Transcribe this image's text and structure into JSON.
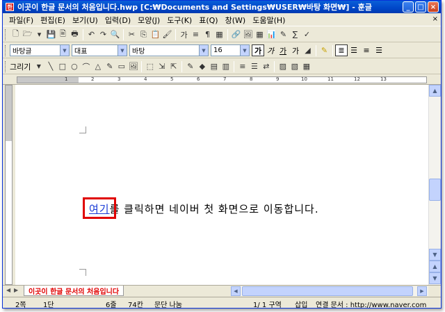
{
  "window": {
    "title": "이곳이 한글 문서의 처음입니다.hwp [C:₩Documents and Settings₩USER₩바탕 화면₩] - 훈글",
    "app_icon": "hwp-app-icon",
    "controls": {
      "minimize": "_",
      "maximize": "□",
      "close": "×"
    }
  },
  "menu": {
    "items": [
      "파일(F)",
      "편집(E)",
      "보기(U)",
      "입력(D)",
      "모양(J)",
      "도구(K)",
      "표(Q)",
      "창(W)",
      "도움말(H)"
    ],
    "close": "×"
  },
  "toolbar1": {
    "icons": [
      "new-doc-icon",
      "open-icon",
      "open-dropdown-icon",
      "save-icon",
      "print-preview-icon",
      "print-icon",
      "undo-icon",
      "redo-icon",
      "find-icon",
      "cut-icon",
      "copy-icon",
      "paste-icon",
      "format-painter-icon",
      "char-shape-icon",
      "para-shape-icon",
      "style-icon",
      "table-icon",
      "link-icon",
      "picture-icon",
      "table-grid-icon",
      "chart-icon",
      "drawing-icon",
      "formula-icon",
      "spell-icon"
    ],
    "glyphs": [
      "🗋",
      "🗁",
      "▾",
      "💾",
      "🖹",
      "🖶",
      "↶",
      "↷",
      "🔍",
      "✂",
      "⎘",
      "📋",
      "🖌",
      "가",
      "≡",
      "¶",
      "▦",
      "🔗",
      "🖼",
      "▦",
      "📊",
      "✎",
      "∑",
      "✓"
    ]
  },
  "toolbar2": {
    "style_combo": "바탕글",
    "lang_combo": "대표",
    "font_combo": "바탕",
    "size_combo": "16",
    "format_buttons": [
      "가",
      "가",
      "가",
      "가"
    ],
    "align_icons": [
      "align-justify-icon",
      "align-left-icon",
      "align-center-icon",
      "align-right-icon"
    ]
  },
  "toolbar3": {
    "draw_label": "그리기",
    "shape_glyphs": [
      "╲",
      "□",
      "○",
      "⌒",
      "△",
      "✎",
      "▭",
      "🖼",
      "⬚",
      "⇲",
      "⇱",
      "✎",
      "◆",
      "▤",
      "▥",
      "≡",
      "☰",
      "⇄",
      "▨",
      "▧",
      "▦"
    ]
  },
  "ruler": {
    "numbers": [
      "1",
      "2",
      "3",
      "4",
      "5",
      "6",
      "7",
      "8",
      "9",
      "10",
      "11",
      "12",
      "13"
    ]
  },
  "document": {
    "link_text": "여기",
    "body_text": "를 클릭하면 네이버 첫 화면으로 이동합니다."
  },
  "tabs": {
    "active_tab": "이곳이 한글 문서의 처음입니다"
  },
  "status": {
    "page": "2쪽",
    "section": "1단",
    "line": "6줄",
    "column": "74칸",
    "paragraph": "문단 나눔",
    "section_info": "1/ 1 구역",
    "mode": "삽입",
    "link": "연결 문서 : http://www.naver.com"
  },
  "colors": {
    "title_bar": "#0046c8",
    "highlight_box": "#e00000",
    "link": "#1a3bd6",
    "tab_text": "#e00000"
  }
}
